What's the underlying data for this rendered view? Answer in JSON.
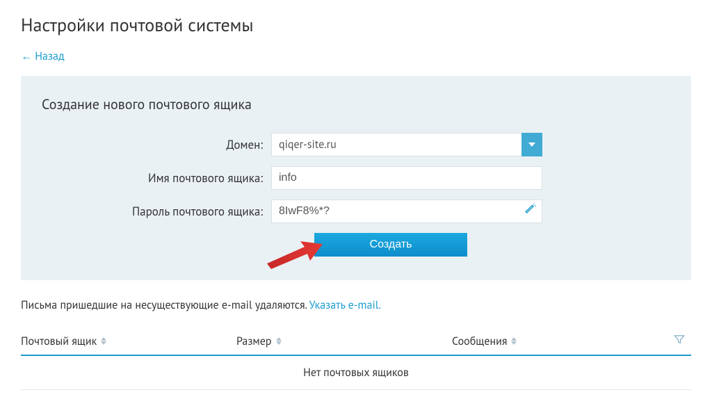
{
  "page_title": "Настройки почтовой системы",
  "back_link": "← Назад",
  "panel": {
    "title": "Создание нового почтового ящика",
    "fields": {
      "domain": {
        "label": "Домен:",
        "value": "qiqer-site.ru"
      },
      "mailbox_name": {
        "label": "Имя почтового ящика:",
        "value": "info"
      },
      "mailbox_password": {
        "label": "Пароль почтового ящика:",
        "value": "8IwF8%*?"
      }
    },
    "create_button": "Создать"
  },
  "notice": {
    "text": "Письма пришедшие на несуществующие e-mail удаляются. ",
    "link_text": "Указать e-mail."
  },
  "table": {
    "headers": {
      "mailbox": "Почтовый ящик",
      "size": "Размер",
      "messages": "Сообщения"
    },
    "empty_text": "Нет почтовых ящиков"
  }
}
